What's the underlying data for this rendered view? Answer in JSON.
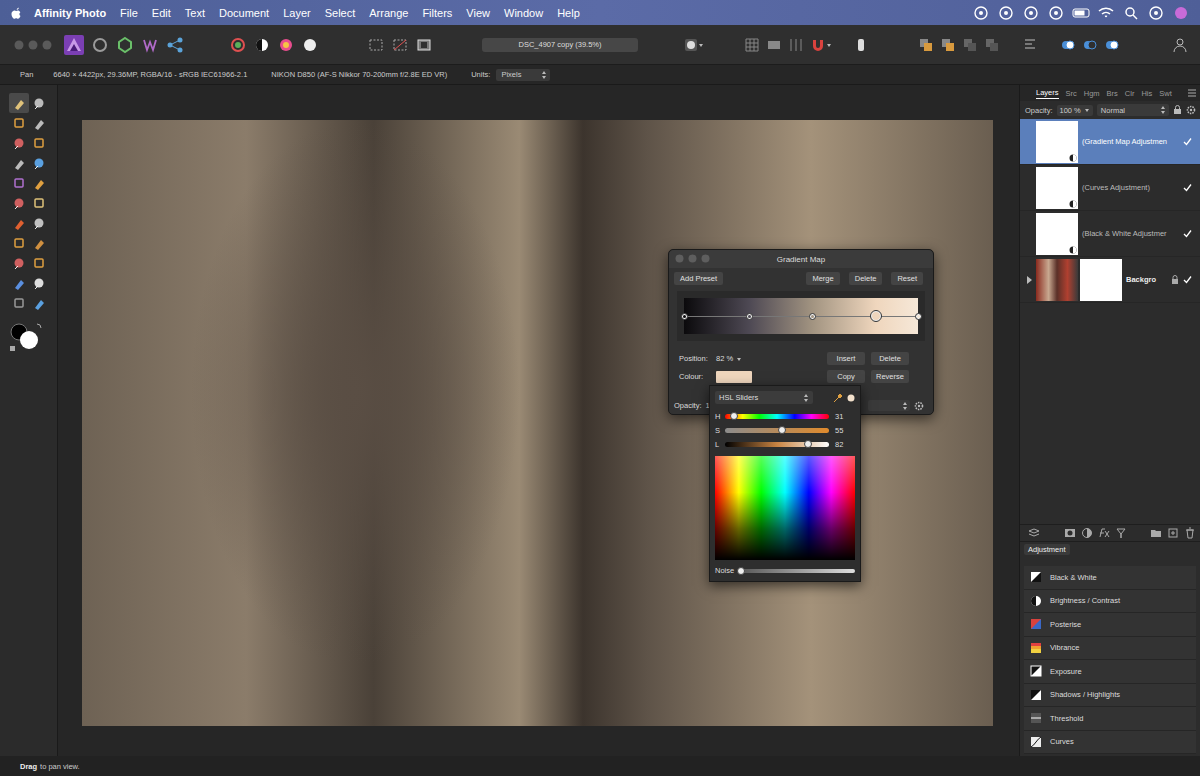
{
  "menu_bar": {
    "app_name": "Affinity Photo",
    "items": [
      "File",
      "Edit",
      "Text",
      "Document",
      "Layer",
      "Select",
      "Arrange",
      "Filters",
      "View",
      "Window",
      "Help"
    ]
  },
  "toolbar": {
    "document_title": "DSC_4907 copy (39.5%)"
  },
  "context_bar": {
    "tool_name": "Pan",
    "image_info": "6640 × 4422px, 29.36MP, RGBA/16 - sRGB IEC61966-2.1",
    "camera": "NIKON D850 (AF-S Nikkor 70-200mm f/2.8E ED VR)",
    "units_label": "Units:",
    "units_value": "Pixels"
  },
  "tools": [
    {
      "selected": true
    },
    {
      "selected": false
    },
    {
      "selected": false
    },
    {
      "selected": false
    },
    {
      "selected": false
    },
    {
      "selected": false
    },
    {
      "selected": false
    },
    {
      "selected": false
    },
    {
      "selected": false
    },
    {
      "selected": false
    },
    {
      "selected": false
    },
    {
      "selected": false
    },
    {
      "selected": false
    },
    {
      "selected": false
    },
    {
      "selected": false
    },
    {
      "selected": false
    },
    {
      "selected": false
    },
    {
      "selected": false
    },
    {
      "selected": false
    },
    {
      "selected": false
    },
    {
      "selected": false
    },
    {
      "selected": false
    }
  ],
  "gradient_map": {
    "title": "Gradient Map",
    "add_preset": "Add Preset",
    "merge": "Merge",
    "delete": "Delete",
    "reset": "Reset",
    "stops": [
      {
        "position": 0,
        "color": "#0b0a0c",
        "selected": false
      },
      {
        "position": 0.28,
        "color": "#4e4954",
        "selected": false
      },
      {
        "position": 0.55,
        "color": "#a29481",
        "selected": false
      },
      {
        "position": 0.82,
        "color": "#efd6bd",
        "selected": true
      },
      {
        "position": 1,
        "color": "#f6e8d8",
        "selected": false
      }
    ],
    "position_label": "Position:",
    "position_value": "82 %",
    "insert": "Insert",
    "delete_stop": "Delete",
    "colour_label": "Colour:",
    "colour": "#efd6bd",
    "copy": "Copy",
    "reverse": "Reverse",
    "opacity_label": "Opacity:",
    "opacity_value": "1"
  },
  "colour_picker": {
    "mode": "HSL Sliders",
    "sliders": [
      {
        "label": "H",
        "value": "31",
        "level": 0.09
      },
      {
        "label": "S",
        "value": "55",
        "level": 0.55
      },
      {
        "label": "L",
        "value": "82",
        "level": 0.8
      }
    ],
    "noise_label": "Noise",
    "noise_level": 0
  },
  "layers_panel": {
    "tabs": [
      {
        "label": "Layers",
        "selected": true
      },
      {
        "label": "Src",
        "selected": false
      },
      {
        "label": "Hgm",
        "selected": false
      },
      {
        "label": "Brs",
        "selected": false
      },
      {
        "label": "Clr",
        "selected": false
      },
      {
        "label": "His",
        "selected": false
      },
      {
        "label": "Swt",
        "selected": false
      }
    ],
    "opacity_label": "Opacity:",
    "opacity_value": "100 %",
    "blend_mode": "Normal",
    "layers": [
      {
        "name": "(Gradient Map Adjustmen",
        "kind": "adjustment",
        "selected": true,
        "visible": true,
        "locked": false
      },
      {
        "name": "(Curves Adjustment)",
        "kind": "adjustment",
        "selected": false,
        "visible": true,
        "locked": false
      },
      {
        "name": "(Black & White Adjustmer",
        "kind": "adjustment",
        "selected": false,
        "visible": true,
        "locked": false
      },
      {
        "name": "Backgro",
        "kind": "pixel",
        "selected": false,
        "visible": true,
        "locked": true
      }
    ]
  },
  "adjustment_panel": {
    "title": "Adjustment",
    "items": [
      "Black & White",
      "Brightness / Contrast",
      "Posterise",
      "Vibrance",
      "Exposure",
      "Shadows / Highlights",
      "Threshold",
      "Curves"
    ]
  },
  "status_bar": {
    "action": "Drag",
    "hint": "to pan view."
  }
}
